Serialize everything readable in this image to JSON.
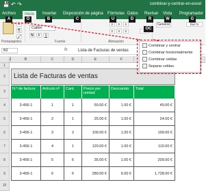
{
  "window": {
    "title": "combinar-y-centrar-en-excel"
  },
  "tabs": [
    {
      "label": "Archivo"
    },
    {
      "label": "Inicio"
    },
    {
      "label": "Insertar"
    },
    {
      "label": "Disposición de página"
    },
    {
      "label": "Fórmulas"
    },
    {
      "label": "Datos"
    },
    {
      "label": "Revisar"
    },
    {
      "label": "Vista"
    },
    {
      "label": "Programador"
    }
  ],
  "keytips": {
    "archivo": "A",
    "inicio": "O",
    "insertar": "B",
    "disposicion": "C",
    "formulas": "U",
    "datos": "D",
    "revisar": "R",
    "vista": "W",
    "programador": "G",
    "merge": "OC"
  },
  "ribbon": {
    "groups": {
      "clipboard": "Portapapeles",
      "font": "Fuente",
      "alignment": "Alineación"
    },
    "font_name": "Calibri",
    "number_format": "General",
    "format_label": "Dar fo"
  },
  "formula_bar": {
    "name_box": "B2",
    "fx": "fx",
    "value": "Lista de Facturas de ventas"
  },
  "menu": {
    "items": [
      "Combinar y centrar",
      "Combinar horizontalmente",
      "Combinar celdas",
      "Separar celdas"
    ]
  },
  "sheet": {
    "columns": [
      "A",
      "B",
      "C",
      "D",
      "E",
      "F",
      "G"
    ],
    "rows": [
      "1",
      "2",
      "3",
      "4",
      "5",
      "6",
      "7",
      "8",
      "9",
      "10",
      "11"
    ],
    "title": "Lista de Facturas de ventas",
    "headers": [
      "N.º de factura",
      "Artículo nº",
      "Cant.",
      "Precio por unidad",
      "Descuento",
      "Total"
    ],
    "data": [
      [
        "3-456-1",
        "1",
        "1",
        "50.00 €",
        "1.00 €",
        "49.00 €"
      ],
      [
        "3-456-1",
        "2",
        "1",
        "25.00 €",
        "1.00 €",
        "24.00 €"
      ],
      [
        "3-456-1",
        "3",
        "2",
        "100.00 €",
        "1.00 €",
        "199.00 €"
      ],
      [
        "3-456-1",
        "4",
        "1",
        "120.00 €",
        "1.00 €",
        "119.00 €"
      ],
      [
        "3-456-1",
        "5",
        "6",
        "35.00 €",
        "1.00 €",
        "209.00 €"
      ],
      [
        "3-456-1",
        "6",
        "6",
        "289.00 €",
        "6.00 €",
        "1,728.00 €"
      ]
    ]
  },
  "colors": {
    "excel_green": "#217346",
    "header_green": "#00b050",
    "keytip_bg": "#1a1a1a",
    "annotation_red": "#e0001a"
  }
}
